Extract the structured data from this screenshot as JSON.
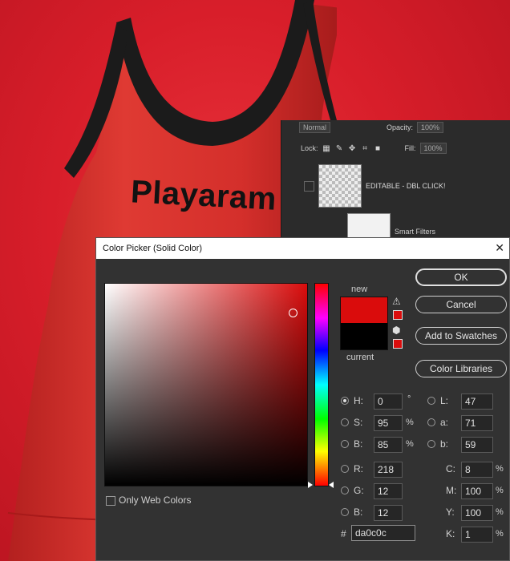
{
  "background": {
    "color": "#d81e2a"
  },
  "shirt": {
    "brand_text": "Playaram",
    "color": "#d62a2a",
    "trim_color": "#1b1b1b"
  },
  "layers_panel": {
    "blend_mode": "Normal",
    "opacity_label": "Opacity:",
    "opacity_value": "100%",
    "lock_label": "Lock:",
    "fill_label": "Fill:",
    "fill_value": "100%",
    "layer_name": "EDITABLE - DBL CLICK!",
    "sublayer_name": "Smart Filters"
  },
  "dialog": {
    "title": "Color Picker (Solid Color)",
    "new_label": "new",
    "current_label": "current",
    "new_color": "#da0c0c",
    "current_color": "#000000",
    "buttons": {
      "ok": "OK",
      "cancel": "Cancel",
      "add_swatches": "Add to Swatches",
      "color_libraries": "Color Libraries"
    },
    "only_web_colors": "Only Web Colors",
    "fields": {
      "H": {
        "label": "H:",
        "value": "0",
        "unit": "°",
        "selected": true
      },
      "S": {
        "label": "S:",
        "value": "95",
        "unit": "%"
      },
      "Bv": {
        "label": "B:",
        "value": "85",
        "unit": "%"
      },
      "R": {
        "label": "R:",
        "value": "218"
      },
      "G": {
        "label": "G:",
        "value": "12"
      },
      "Bl": {
        "label": "B:",
        "value": "12"
      },
      "L": {
        "label": "L:",
        "value": "47"
      },
      "a": {
        "label": "a:",
        "value": "71"
      },
      "b": {
        "label": "b:",
        "value": "59"
      },
      "C": {
        "label": "C:",
        "value": "8",
        "unit": "%"
      },
      "M": {
        "label": "M:",
        "value": "100",
        "unit": "%"
      },
      "Y": {
        "label": "Y:",
        "value": "100",
        "unit": "%"
      },
      "K": {
        "label": "K:",
        "value": "1",
        "unit": "%"
      }
    },
    "hex_label": "#",
    "hex_value": "da0c0c"
  }
}
